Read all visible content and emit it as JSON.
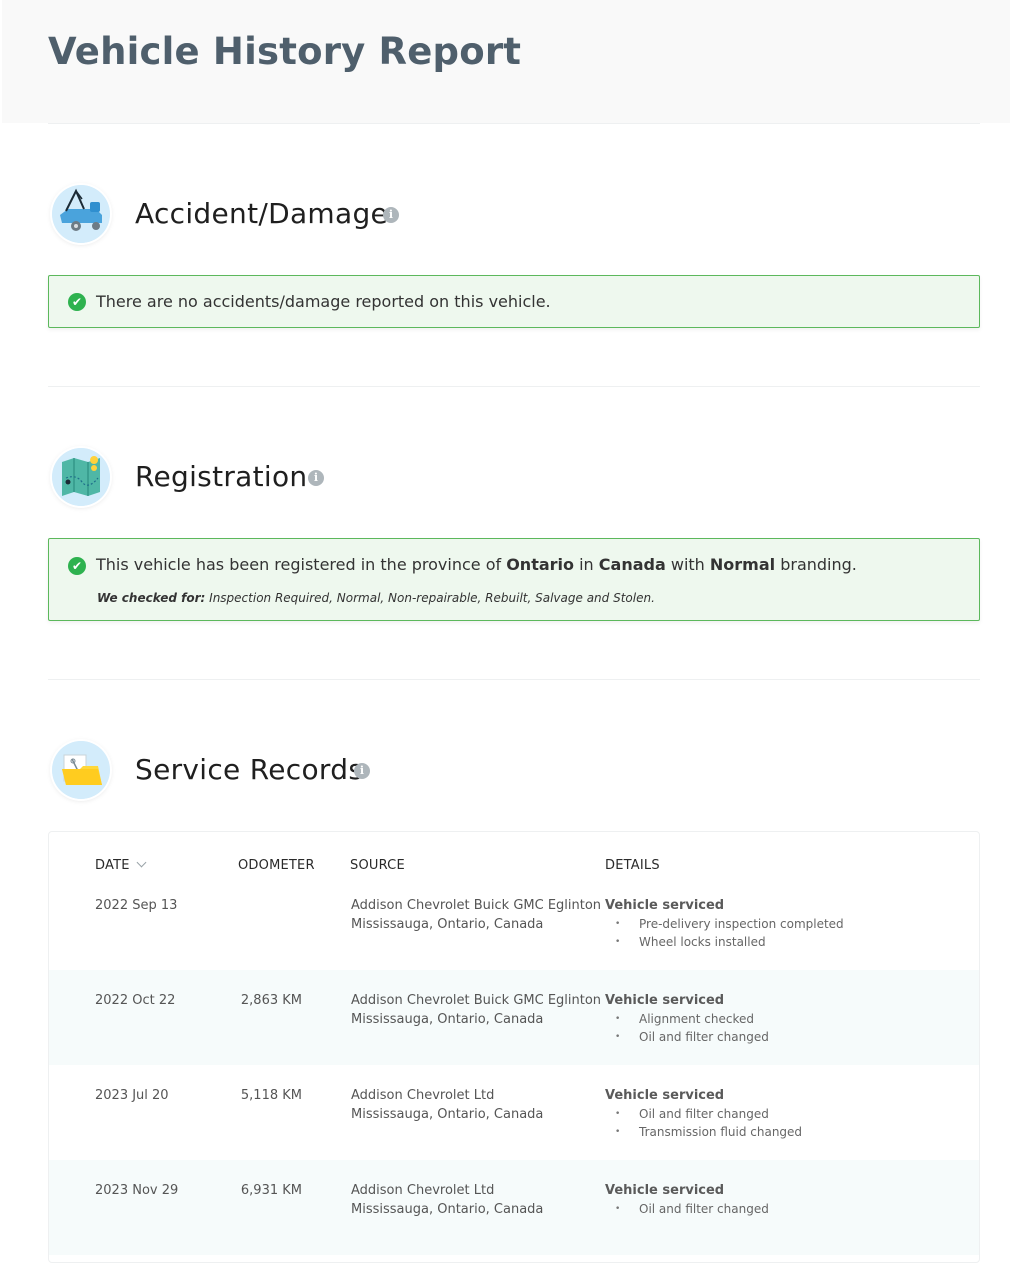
{
  "header": {
    "title": "Vehicle History Report"
  },
  "accident": {
    "title": "Accident/Damage",
    "info_icon": "i",
    "message": "There are no accidents/damage reported on this vehicle."
  },
  "registration": {
    "title": "Registration",
    "info_icon": "i",
    "message_prefix": "This vehicle has been registered in the province of ",
    "province": "Ontario",
    "message_in": " in ",
    "country": "Canada",
    "message_with": " with ",
    "branding": "Normal",
    "message_suffix": " branding.",
    "checked_label": "We checked for:",
    "checked_items": " Inspection Required, Normal, Non-repairable, Rebuilt, Salvage and Stolen."
  },
  "service": {
    "title": "Service Records",
    "info_icon": "i",
    "columns": {
      "date": "DATE",
      "odometer": "ODOMETER",
      "source": "SOURCE",
      "details": "DETAILS"
    },
    "records": [
      {
        "date": "2022 Sep 13",
        "odometer": "",
        "source_name": "Addison Chevrolet Buick GMC Eglinton",
        "source_location": "Mississauga, Ontario, Canada",
        "detail_title": "Vehicle serviced",
        "items": [
          "Pre-delivery inspection completed",
          "Wheel locks installed"
        ]
      },
      {
        "date": "2022 Oct 22",
        "odometer": "2,863 KM",
        "source_name": "Addison Chevrolet Buick GMC Eglinton",
        "source_location": "Mississauga, Ontario, Canada",
        "detail_title": "Vehicle serviced",
        "items": [
          "Alignment checked",
          "Oil and filter changed"
        ]
      },
      {
        "date": "2023 Jul 20",
        "odometer": "5,118 KM",
        "source_name": "Addison Chevrolet Ltd",
        "source_location": "Mississauga, Ontario, Canada",
        "detail_title": "Vehicle serviced",
        "items": [
          "Oil and filter changed",
          "Transmission fluid changed"
        ]
      },
      {
        "date": "2023 Nov 29",
        "odometer": "6,931 KM",
        "source_name": "Addison Chevrolet Ltd",
        "source_location": "Mississauga, Ontario, Canada",
        "detail_title": "Vehicle serviced",
        "items": [
          "Oil and filter changed"
        ]
      }
    ]
  },
  "icons": {
    "accident": "tow-truck-icon",
    "registration": "map-icon",
    "service": "folder-icon",
    "check": "check-circle-icon",
    "info": "info-icon",
    "sort": "chevron-down-icon"
  },
  "colors": {
    "success_border": "#5cb85c",
    "success_bg": "#eef8ee",
    "check": "#2eb24f",
    "title": "#4f5f6c"
  }
}
